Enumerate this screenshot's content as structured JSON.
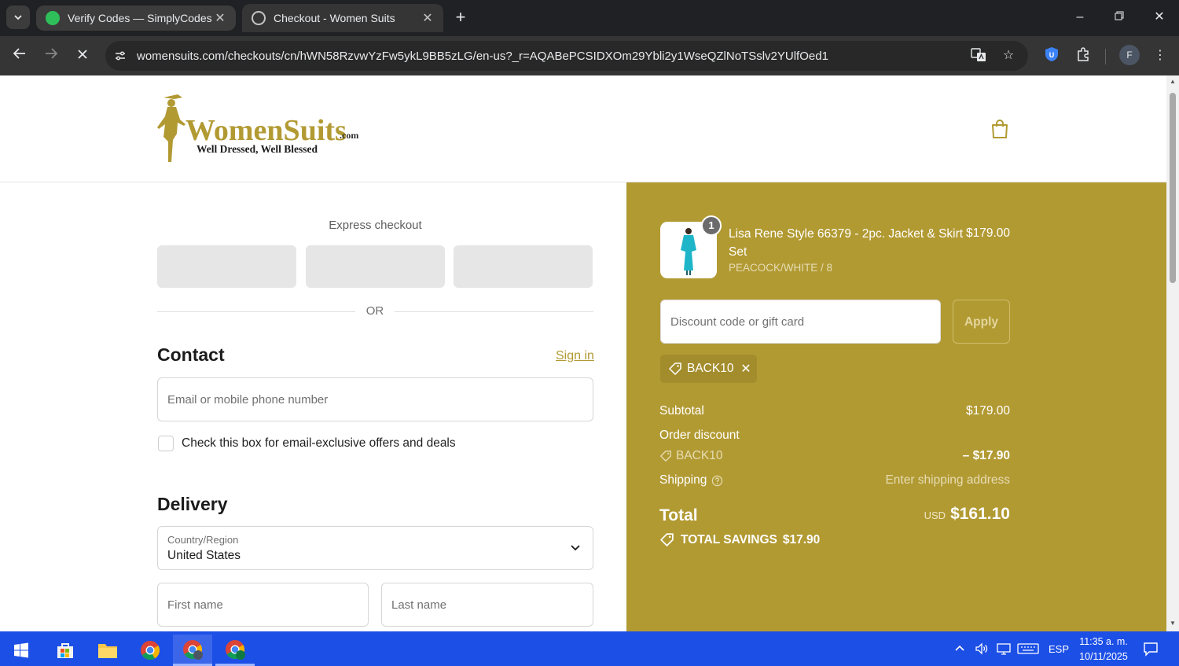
{
  "browser": {
    "tabs": [
      {
        "title": "Verify Codes — SimplyCodes",
        "favicon": "simplycodes-icon",
        "active": false
      },
      {
        "title": "Checkout - Women Suits",
        "favicon": "loading-globe-icon",
        "active": true
      }
    ],
    "url": "womensuits.com/checkouts/cn/hWN58RzvwYzFw5ykL9BB5zLG/en-us?_r=AQABePCSIDXOm29Ybli2y1WseQZlNoTSslv2YUlfOed1",
    "profile_initial": "F"
  },
  "logo": {
    "name": "WomenSuits",
    "suffix": ".com",
    "tagline": "Well Dressed, Well Blessed",
    "color": "#b29a33"
  },
  "checkout": {
    "express_label": "Express checkout",
    "or_text": "OR",
    "contact": {
      "heading": "Contact",
      "sign_in": "Sign in",
      "email_placeholder": "Email or mobile phone number",
      "offers_label": "Check this box for email-exclusive offers and deals"
    },
    "delivery": {
      "heading": "Delivery",
      "country_label": "Country/Region",
      "country_value": "United States",
      "first_name_placeholder": "First name",
      "last_name_placeholder": "Last name"
    }
  },
  "summary": {
    "accent_color": "#b29a33",
    "item": {
      "quantity": "1",
      "name": "Lisa Rene Style 66379 - 2pc. Jacket & Skirt Set",
      "variant": "PEACOCK/WHITE / 8",
      "price": "$179.00"
    },
    "discount_placeholder": "Discount code or gift card",
    "apply_label": "Apply",
    "applied_code": "BACK10",
    "subtotal_label": "Subtotal",
    "subtotal_value": "$179.00",
    "order_discount_label": "Order discount",
    "discount_code": "BACK10",
    "discount_value": "– $17.90",
    "shipping_label": "Shipping",
    "shipping_value": "Enter shipping address",
    "total_label": "Total",
    "total_currency": "USD",
    "total_value": "$161.10",
    "savings_label": "TOTAL SAVINGS",
    "savings_value": "$17.90"
  },
  "taskbar": {
    "language": "ESP",
    "time": "11:35 a. m.",
    "date": "10/11/2025"
  }
}
